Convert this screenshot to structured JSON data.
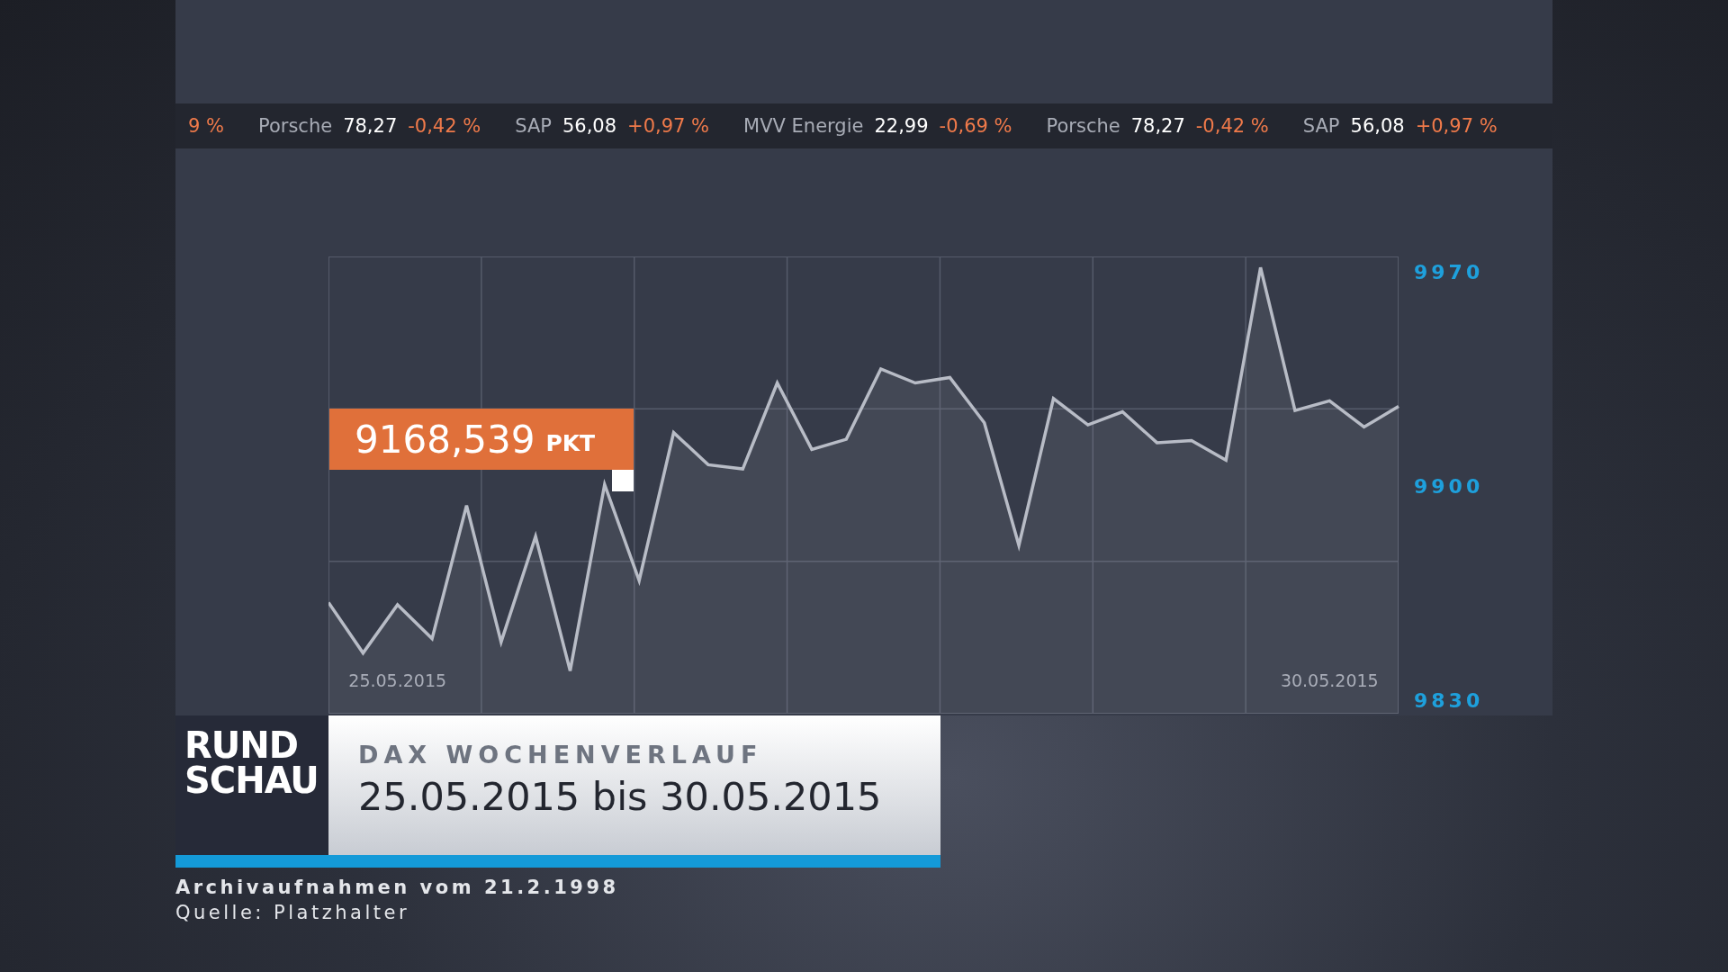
{
  "ticker": [
    {
      "change": "9 %"
    },
    {
      "name": "Porsche",
      "value": "78,27",
      "change": "-0,42 %"
    },
    {
      "name": "SAP",
      "value": "56,08",
      "change": "+0,97 %"
    },
    {
      "name": "MVV Energie",
      "value": "22,99",
      "change": "-0,69 %"
    },
    {
      "name": "Porsche",
      "value": "78,27",
      "change": "-0,42 %"
    },
    {
      "name": "SAP",
      "value": "56,08",
      "change": "+0,97 %"
    }
  ],
  "chart": {
    "marker": {
      "value": "9168,539",
      "unit": "PKT"
    },
    "chart_data": {
      "type": "area",
      "categories": [
        null,
        null,
        "25.05.2015",
        null,
        null,
        null,
        null,
        null,
        null,
        null,
        null,
        null,
        null,
        null,
        null,
        null,
        null,
        null,
        null,
        null,
        null,
        null,
        null,
        null,
        null,
        null,
        null,
        null,
        null,
        "30.05.2015",
        null,
        null
      ],
      "series": [
        {
          "color": "#b8bcc6",
          "values": [
            9862,
            9845.5,
            9861.3,
            9850.2,
            9893.7,
            9849.1,
            9883.6,
            9839.7,
            9900.5,
            9869.2,
            9917.5,
            9907,
            9905.6,
            9933.7,
            9912,
            9915.3,
            9938.3,
            9933.7,
            9935.5,
            9920.7,
            9880.7,
            9928.6,
            9920,
            9924.3,
            9914.2,
            9914.9,
            9908.5,
            9971.4,
            9924.7,
            9927.9,
            9919.3,
            9926.1
          ]
        }
      ],
      "ylim": [
        9825.7,
        9975
      ],
      "yticks": [
        9830,
        9900,
        9970
      ]
    }
  },
  "lower_third": {
    "logo": "RUND SCHAU",
    "kicker": "DAX WOCHENVERLAUF",
    "headline": "25.05.2015 bis 30.05.2015"
  },
  "captions": [
    "Archivaufnahmen vom 21.2.1998",
    "Quelle: Platzhalter"
  ]
}
